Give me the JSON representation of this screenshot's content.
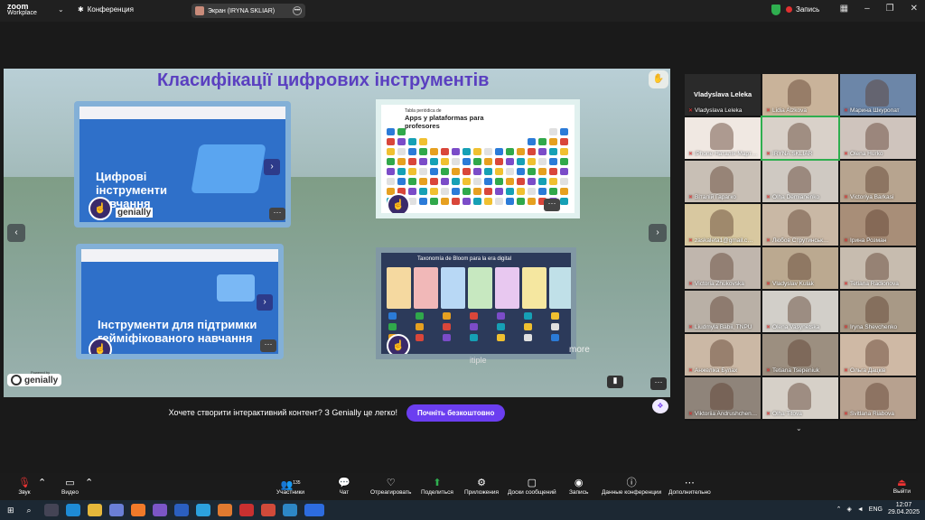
{
  "app": {
    "title_line1": "zoom",
    "title_line2": "Workplace",
    "conference_label": "Конференция",
    "screen_share_label": "Экран (IRYNA SKLIAR)",
    "record_label": "Запись"
  },
  "slide": {
    "title": "Класифікації цифрових інструментів",
    "card1_text": "Цифрові інструменти навчання",
    "card2_title": "Tabla periódica de",
    "card2_heading": "Apps y plataformas para profesores",
    "card3_text": "Інструменти для підтримки гейміфікованого навчання",
    "card4_title": "Taxonomía de Bloom para la era digital",
    "brand": "genially",
    "brand_sub": "EDUCATION",
    "powered_by": "Powered by",
    "more_text": "more",
    "more_text2": "itiple"
  },
  "promo": {
    "text": "Хочете створити інтерактивний контент? З Genially це легко!",
    "cta": "Почніть безкоштовно"
  },
  "gallery": {
    "active_speaker": "Vladyslava Leleka",
    "participants": [
      "Vladyslava Leleka",
      "Lidia Alzkova",
      "Марина Шкуропат",
      "iPhone Наталія Март…",
      "IRYNA SKLIAR",
      "Olena Hurko",
      "Віталій Гарагко",
      "Olha Demianenko",
      "Victoriya Barkasi",
      "zaskaleta1@gmail.c…",
      "Любов Струтинськ…",
      "Ірина Розман",
      "Victoria Zhukovska",
      "Vladyslav Kulak",
      "Tetiana Radionova",
      "Liudmyla Babii, TNPU",
      "Olena Vasynetska",
      "Iryna Shevchenko",
      "Анжеліка Булах",
      "Tetiana Tsepeniuk",
      "Ольга Дацків",
      "Viktoriia Andrushchen…",
      "Olha Titova",
      "Svitlana Riabova"
    ]
  },
  "toolbar": {
    "audio": "Звук",
    "video": "Видео",
    "participants": "Участники",
    "participants_count": "135",
    "chat": "Чат",
    "react": "Отреагировать",
    "share": "Поделиться",
    "apps": "Приложения",
    "whiteboards": "Доски сообщений",
    "record": "Запись",
    "conf_info": "Данные конференции",
    "more": "Дополнительно",
    "leave": "Выйти"
  },
  "taskbar": {
    "lang": "ENG",
    "time": "12:07",
    "date": "29.04.2025"
  },
  "colors": {
    "accent": "#6b3ef0",
    "record": "#e03030",
    "secure": "#2fae4f"
  }
}
